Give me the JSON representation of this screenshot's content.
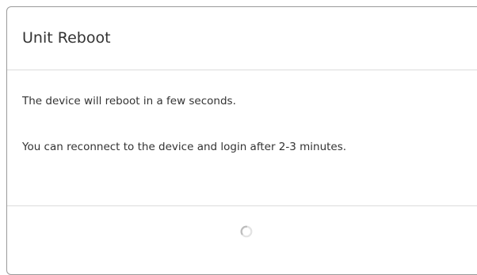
{
  "dialog": {
    "title": "Unit Reboot",
    "messages": [
      "The device will reboot in a few seconds.",
      "You can reconnect to the device and login after 2-3 minutes."
    ],
    "footer": {
      "spinner_icon": "loading-spinner-icon"
    }
  },
  "colors": {
    "border": "#9a9a9a",
    "divider": "#dcdcdc",
    "text": "#333333",
    "spinner": "#c8c8c8"
  }
}
